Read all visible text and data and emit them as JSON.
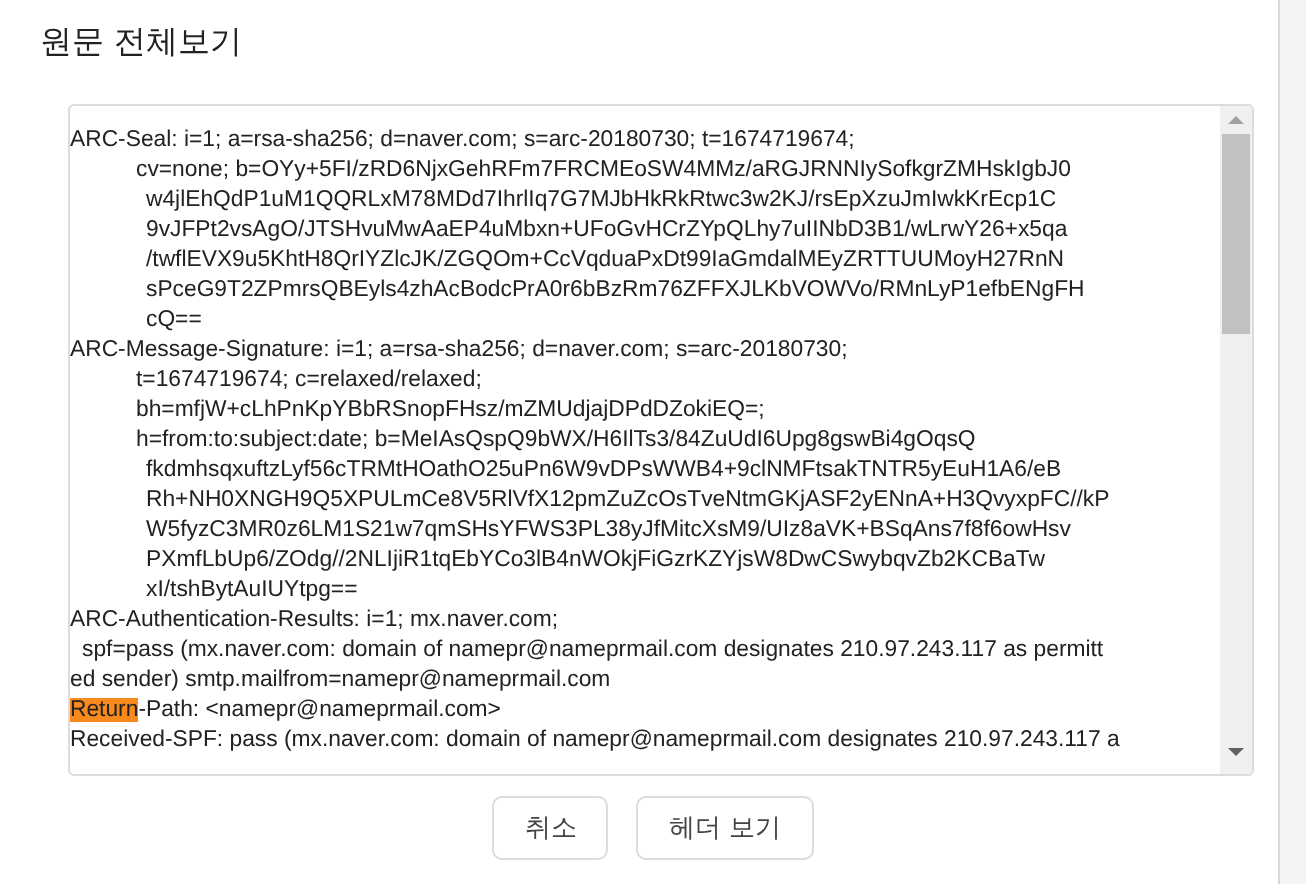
{
  "dialog": {
    "title": "원문 전체보기"
  },
  "source": {
    "lines": [
      {
        "kind": "field",
        "parts": [
          {
            "text": "ARC-Seal: i=1; a=rsa-sha256; d=naver.com; s=arc-20180730; t=1674719674;",
            "highlighted": false
          }
        ]
      },
      {
        "kind": "continued",
        "parts": [
          {
            "text": "cv=none; b=OYy+5FI/zRD6NjxGehRFm7FRCMEoSW4MMz/aRGJRNNIySofkgrZMHskIgbJ0",
            "highlighted": false
          }
        ]
      },
      {
        "kind": "wrapped",
        "parts": [
          {
            "text": "w4jlEhQdP1uM1QQRLxM78MDd7IhrlIq7G7MJbHkRkRtwc3w2KJ/rsEpXzuJmIwkKrEcp1C",
            "highlighted": false
          }
        ]
      },
      {
        "kind": "wrapped",
        "parts": [
          {
            "text": "9vJFPt2vsAgO/JTSHvuMwAaEP4uMbxn+UFoGvHCrZYpQLhy7uIINbD3B1/wLrwY26+x5qa",
            "highlighted": false
          }
        ]
      },
      {
        "kind": "wrapped",
        "parts": [
          {
            "text": "/twflEVX9u5KhtH8QrIYZlcJK/ZGQOm+CcVqduaPxDt99IaGmdalMEyZRTTUUMoyH27RnN",
            "highlighted": false
          }
        ]
      },
      {
        "kind": "wrapped",
        "parts": [
          {
            "text": "sPceG9T2ZPmrsQBEyls4zhAcBodcPrA0r6bBzRm76ZFFXJLKbVOWVo/RMnLyP1efbENgFH",
            "highlighted": false
          }
        ]
      },
      {
        "kind": "wrapped",
        "parts": [
          {
            "text": "cQ==",
            "highlighted": false
          }
        ]
      },
      {
        "kind": "field",
        "parts": [
          {
            "text": "ARC-Message-Signature: i=1; a=rsa-sha256; d=naver.com; s=arc-20180730;",
            "highlighted": false
          }
        ]
      },
      {
        "kind": "continued",
        "parts": [
          {
            "text": "t=1674719674; c=relaxed/relaxed;",
            "highlighted": false
          }
        ]
      },
      {
        "kind": "continued",
        "parts": [
          {
            "text": "bh=mfjW+cLhPnKpYBbRSnopFHsz/mZMUdjajDPdDZokiEQ=;",
            "highlighted": false
          }
        ]
      },
      {
        "kind": "continued",
        "parts": [
          {
            "text": "h=from:to:subject:date; b=MeIAsQspQ9bWX/H6IlTs3/84ZuUdI6Upg8gswBi4gOqsQ",
            "highlighted": false
          }
        ]
      },
      {
        "kind": "wrapped",
        "parts": [
          {
            "text": "fkdmhsqxuftzLyf56cTRMtHOathO25uPn6W9vDPsWWB4+9clNMFtsakTNTR5yEuH1A6/eB",
            "highlighted": false
          }
        ]
      },
      {
        "kind": "wrapped",
        "parts": [
          {
            "text": "Rh+NH0XNGH9Q5XPULmCe8V5RlVfX12pmZuZcOsTveNtmGKjASF2yENnA+H3QvyxpFC//kP",
            "highlighted": false
          }
        ]
      },
      {
        "kind": "wrapped",
        "parts": [
          {
            "text": "W5fyzC3MR0z6LM1S21w7qmSHsYFWS3PL38yJfMitcXsM9/UIz8aVK+BSqAns7f8f6owHsv",
            "highlighted": false
          }
        ]
      },
      {
        "kind": "wrapped",
        "parts": [
          {
            "text": "PXmfLbUp6/ZOdg//2NLIjiR1tqEbYCo3lB4nWOkjFiGzrKZYjsW8DwCSwybqvZb2KCBaTw",
            "highlighted": false
          }
        ]
      },
      {
        "kind": "wrapped",
        "parts": [
          {
            "text": "xI/tshBytAuIUYtpg==",
            "highlighted": false
          }
        ]
      },
      {
        "kind": "field",
        "parts": [
          {
            "text": "ARC-Authentication-Results: i=1; mx.naver.com;",
            "highlighted": false
          }
        ]
      },
      {
        "kind": "space",
        "parts": [
          {
            "text": "spf=pass (mx.naver.com: domain of namepr@nameprmail.com designates 210.97.243.117 as permitt",
            "highlighted": false
          }
        ]
      },
      {
        "kind": "field",
        "parts": [
          {
            "text": "ed sender) smtp.mailfrom=namepr@nameprmail.com",
            "highlighted": false
          }
        ]
      },
      {
        "kind": "field",
        "parts": [
          {
            "text": "Return",
            "highlighted": true
          },
          {
            "text": "-Path: <namepr@nameprmail.com>",
            "highlighted": false
          }
        ]
      },
      {
        "kind": "field",
        "parts": [
          {
            "text": "Received-SPF: pass (mx.naver.com: domain of namepr@nameprmail.com designates 210.97.243.117 a",
            "highlighted": false
          }
        ]
      }
    ]
  },
  "buttons": [
    {
      "label": "취소"
    },
    {
      "label": "헤더 보기"
    }
  ]
}
